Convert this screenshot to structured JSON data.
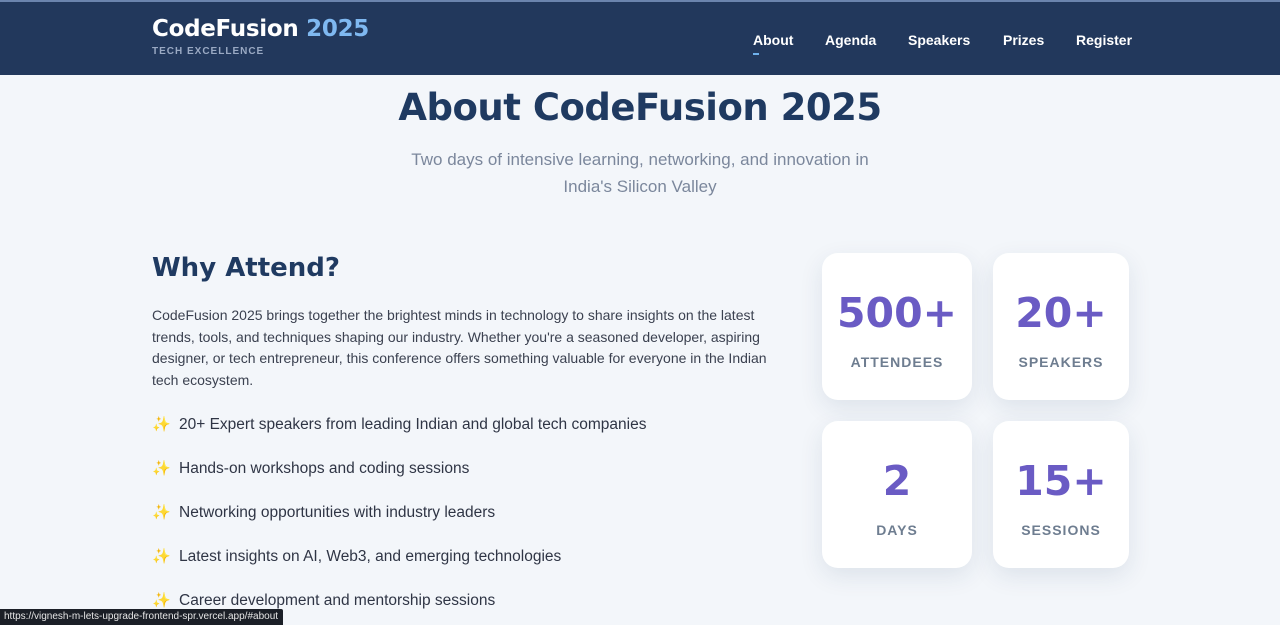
{
  "brand": {
    "name": "CodeFusion",
    "year": "2025",
    "tagline": "TECH EXCELLENCE"
  },
  "nav": {
    "items": [
      {
        "label": "About",
        "active": true
      },
      {
        "label": "Agenda",
        "active": false
      },
      {
        "label": "Speakers",
        "active": false
      },
      {
        "label": "Prizes",
        "active": false
      },
      {
        "label": "Register",
        "active": false
      }
    ]
  },
  "about": {
    "title": "About CodeFusion 2025",
    "subtitle": "Two days of intensive learning, networking, and innovation in India's Silicon Valley"
  },
  "why": {
    "title": "Why Attend?",
    "body": "CodeFusion 2025 brings together the brightest minds in technology to share insights on the latest trends, tools, and techniques shaping our industry. Whether you're a seasoned developer, aspiring designer, or tech entrepreneur, this conference offers something valuable for everyone in the Indian tech ecosystem.",
    "bullet_icon": "sparkles-icon",
    "bullets": [
      "20+ Expert speakers from leading Indian and global tech companies",
      "Hands-on workshops and coding sessions",
      "Networking opportunities with industry leaders",
      "Latest insights on AI, Web3, and emerging technologies",
      "Career development and mentorship sessions"
    ]
  },
  "stats": [
    {
      "value": "500+",
      "label": "ATTENDEES"
    },
    {
      "value": "20+",
      "label": "SPEAKERS"
    },
    {
      "value": "2",
      "label": "DAYS"
    },
    {
      "value": "15+",
      "label": "SESSIONS"
    }
  ],
  "status_url": "https://vignesh-m-lets-upgrade-frontend-spr.vercel.app/#about",
  "colors": {
    "header_bg": "#22385c",
    "accent_blue": "#7fb8f0",
    "stat_purple": "#6a5bc4",
    "heading_navy": "#1f3a61"
  }
}
